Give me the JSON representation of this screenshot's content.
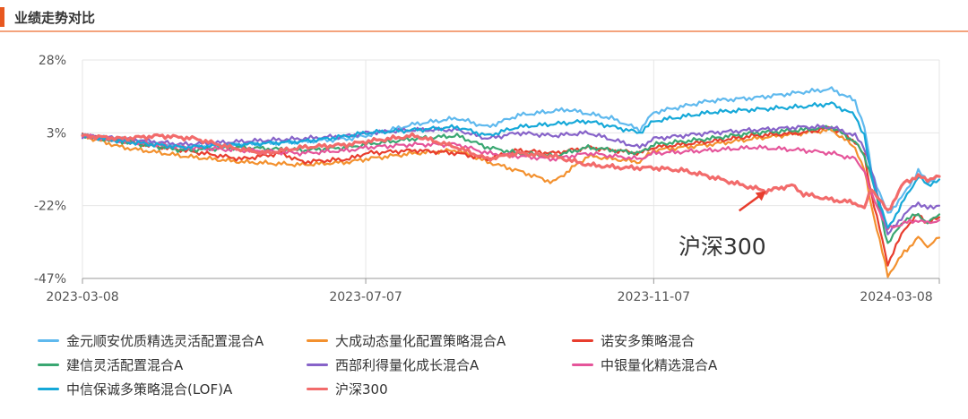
{
  "header": {
    "title": "业绩走势对比"
  },
  "chart_data": {
    "type": "line",
    "x_ticks": [
      "2023-03-08",
      "2023-07-07",
      "2023-11-07",
      "2024-03-08"
    ],
    "y_ticks": [
      "28%",
      "3%",
      "-22%",
      "-47%"
    ],
    "ylim": [
      -47,
      28
    ],
    "xlim": [
      "2023-03-08",
      "2024-03-08"
    ],
    "grid": true,
    "legend_position": "bottom",
    "annotation": {
      "text": "沪深300",
      "target_x": "2023-12-25",
      "target_y": -17
    },
    "series": [
      {
        "name": "金元顺安优质精选灵活配置混合A",
        "color": "#5fb9ee",
        "points": [
          [
            "2023-03-08",
            2
          ],
          [
            "2023-03-25",
            1
          ],
          [
            "2023-04-20",
            -2
          ],
          [
            "2023-05-15",
            -1
          ],
          [
            "2023-06-10",
            0
          ],
          [
            "2023-06-30",
            1
          ],
          [
            "2023-07-07",
            2
          ],
          [
            "2023-07-28",
            6
          ],
          [
            "2023-08-15",
            8
          ],
          [
            "2023-08-28",
            5
          ],
          [
            "2023-09-10",
            9
          ],
          [
            "2023-10-01",
            11
          ],
          [
            "2023-10-20",
            8
          ],
          [
            "2023-11-01",
            4
          ],
          [
            "2023-11-07",
            10
          ],
          [
            "2023-12-01",
            14
          ],
          [
            "2023-12-20",
            15
          ],
          [
            "2024-01-10",
            17
          ],
          [
            "2024-01-22",
            18
          ],
          [
            "2024-02-01",
            14
          ],
          [
            "2024-02-05",
            5
          ],
          [
            "2024-02-08",
            -10
          ],
          [
            "2024-02-15",
            -25
          ],
          [
            "2024-02-22",
            -18
          ],
          [
            "2024-02-28",
            -10
          ],
          [
            "2024-03-03",
            -14
          ],
          [
            "2024-03-08",
            -12
          ]
        ]
      },
      {
        "name": "大成动态量化配置策略混合A",
        "color": "#f3912f",
        "points": [
          [
            "2023-03-08",
            2
          ],
          [
            "2023-03-25",
            -2
          ],
          [
            "2023-04-20",
            -5
          ],
          [
            "2023-05-15",
            -7
          ],
          [
            "2023-06-10",
            -8
          ],
          [
            "2023-06-30",
            -7
          ],
          [
            "2023-07-07",
            -6
          ],
          [
            "2023-07-28",
            -4
          ],
          [
            "2023-08-15",
            -3
          ],
          [
            "2023-08-28",
            -7
          ],
          [
            "2023-09-10",
            -10
          ],
          [
            "2023-09-25",
            -14
          ],
          [
            "2023-10-10",
            -5
          ],
          [
            "2023-11-01",
            -7
          ],
          [
            "2023-11-07",
            -3
          ],
          [
            "2023-12-01",
            -1
          ],
          [
            "2023-12-20",
            1
          ],
          [
            "2024-01-10",
            3
          ],
          [
            "2024-01-22",
            4
          ],
          [
            "2024-02-01",
            -2
          ],
          [
            "2024-02-05",
            -10
          ],
          [
            "2024-02-08",
            -22
          ],
          [
            "2024-02-15",
            -46
          ],
          [
            "2024-02-22",
            -38
          ],
          [
            "2024-02-28",
            -33
          ],
          [
            "2024-03-03",
            -36
          ],
          [
            "2024-03-08",
            -33
          ]
        ]
      },
      {
        "name": "诺安多策略混合",
        "color": "#e83d2e",
        "points": [
          [
            "2023-03-08",
            2
          ],
          [
            "2023-03-25",
            0
          ],
          [
            "2023-04-20",
            -3
          ],
          [
            "2023-05-15",
            -6
          ],
          [
            "2023-06-01",
            -4
          ],
          [
            "2023-06-10",
            -7
          ],
          [
            "2023-06-30",
            -6
          ],
          [
            "2023-07-07",
            -4
          ],
          [
            "2023-07-28",
            -3
          ],
          [
            "2023-08-15",
            -4
          ],
          [
            "2023-08-28",
            -6
          ],
          [
            "2023-09-10",
            -3
          ],
          [
            "2023-09-25",
            -4
          ],
          [
            "2023-10-10",
            -2
          ],
          [
            "2023-11-01",
            -4
          ],
          [
            "2023-11-07",
            -2
          ],
          [
            "2023-12-01",
            0
          ],
          [
            "2023-12-20",
            2
          ],
          [
            "2024-01-10",
            3
          ],
          [
            "2024-01-22",
            5
          ],
          [
            "2024-02-01",
            0
          ],
          [
            "2024-02-05",
            -5
          ],
          [
            "2024-02-08",
            -18
          ],
          [
            "2024-02-15",
            -42
          ],
          [
            "2024-02-22",
            -30
          ],
          [
            "2024-02-28",
            -25
          ],
          [
            "2024-03-03",
            -28
          ],
          [
            "2024-03-08",
            -26
          ]
        ]
      },
      {
        "name": "建信灵活配置混合A",
        "color": "#3aa772",
        "points": [
          [
            "2023-03-08",
            2
          ],
          [
            "2023-03-25",
            0
          ],
          [
            "2023-04-20",
            -3
          ],
          [
            "2023-05-15",
            -2
          ],
          [
            "2023-06-10",
            -3
          ],
          [
            "2023-06-30",
            -2
          ],
          [
            "2023-07-07",
            -1
          ],
          [
            "2023-07-28",
            1
          ],
          [
            "2023-08-15",
            2
          ],
          [
            "2023-08-28",
            -2
          ],
          [
            "2023-09-10",
            -4
          ],
          [
            "2023-09-25",
            -5
          ],
          [
            "2023-10-10",
            -2
          ],
          [
            "2023-11-01",
            -4
          ],
          [
            "2023-11-07",
            -1
          ],
          [
            "2023-12-01",
            1
          ],
          [
            "2023-12-20",
            3
          ],
          [
            "2024-01-10",
            4
          ],
          [
            "2024-01-22",
            5
          ],
          [
            "2024-02-01",
            0
          ],
          [
            "2024-02-05",
            -5
          ],
          [
            "2024-02-08",
            -12
          ],
          [
            "2024-02-15",
            -35
          ],
          [
            "2024-02-22",
            -27
          ],
          [
            "2024-02-28",
            -25
          ],
          [
            "2024-03-03",
            -28
          ],
          [
            "2024-03-08",
            -25
          ]
        ]
      },
      {
        "name": "西部利得量化成长混合A",
        "color": "#8763c9",
        "points": [
          [
            "2023-03-08",
            2
          ],
          [
            "2023-03-25",
            1
          ],
          [
            "2023-04-20",
            -1
          ],
          [
            "2023-05-15",
            0
          ],
          [
            "2023-06-10",
            1
          ],
          [
            "2023-06-30",
            2
          ],
          [
            "2023-07-07",
            3
          ],
          [
            "2023-07-28",
            4
          ],
          [
            "2023-08-15",
            4
          ],
          [
            "2023-08-28",
            1
          ],
          [
            "2023-09-10",
            3
          ],
          [
            "2023-09-25",
            2
          ],
          [
            "2023-10-10",
            3
          ],
          [
            "2023-11-01",
            -2
          ],
          [
            "2023-11-07",
            1
          ],
          [
            "2023-12-01",
            3
          ],
          [
            "2023-12-20",
            4
          ],
          [
            "2024-01-10",
            5
          ],
          [
            "2024-01-22",
            5
          ],
          [
            "2024-02-01",
            2
          ],
          [
            "2024-02-05",
            -2
          ],
          [
            "2024-02-08",
            -10
          ],
          [
            "2024-02-15",
            -32
          ],
          [
            "2024-02-22",
            -25
          ],
          [
            "2024-02-28",
            -21
          ],
          [
            "2024-03-03",
            -23
          ],
          [
            "2024-03-08",
            -22
          ]
        ]
      },
      {
        "name": "中银量化精选混合A",
        "color": "#e5559a",
        "points": [
          [
            "2023-03-08",
            2
          ],
          [
            "2023-03-25",
            0
          ],
          [
            "2023-04-20",
            -2
          ],
          [
            "2023-05-15",
            -3
          ],
          [
            "2023-06-10",
            -4
          ],
          [
            "2023-06-30",
            -3
          ],
          [
            "2023-07-07",
            -2
          ],
          [
            "2023-07-28",
            -1
          ],
          [
            "2023-08-15",
            -1
          ],
          [
            "2023-08-28",
            -4
          ],
          [
            "2023-09-10",
            -5
          ],
          [
            "2023-09-25",
            -6
          ],
          [
            "2023-10-10",
            -4
          ],
          [
            "2023-11-01",
            -6
          ],
          [
            "2023-11-07",
            -4
          ],
          [
            "2023-12-01",
            -3
          ],
          [
            "2023-12-20",
            -2
          ],
          [
            "2024-01-10",
            -3
          ],
          [
            "2024-01-22",
            -4
          ],
          [
            "2024-02-01",
            -6
          ],
          [
            "2024-02-05",
            -10
          ],
          [
            "2024-02-08",
            -18
          ],
          [
            "2024-02-15",
            -30
          ],
          [
            "2024-02-22",
            -28
          ],
          [
            "2024-02-28",
            -27
          ],
          [
            "2024-03-03",
            -28
          ],
          [
            "2024-03-08",
            -27
          ]
        ]
      },
      {
        "name": "中信保诚多策略混合(LOF)A",
        "color": "#15a8d8",
        "points": [
          [
            "2023-03-08",
            2
          ],
          [
            "2023-03-25",
            0
          ],
          [
            "2023-04-20",
            -2
          ],
          [
            "2023-05-15",
            -1
          ],
          [
            "2023-06-10",
            0
          ],
          [
            "2023-06-30",
            2
          ],
          [
            "2023-07-07",
            3
          ],
          [
            "2023-07-28",
            4
          ],
          [
            "2023-08-15",
            5
          ],
          [
            "2023-08-28",
            2
          ],
          [
            "2023-09-10",
            5
          ],
          [
            "2023-09-25",
            6
          ],
          [
            "2023-10-10",
            7
          ],
          [
            "2023-11-01",
            3
          ],
          [
            "2023-11-07",
            7
          ],
          [
            "2023-12-01",
            10
          ],
          [
            "2023-12-20",
            11
          ],
          [
            "2024-01-10",
            12
          ],
          [
            "2024-01-22",
            13
          ],
          [
            "2024-02-01",
            9
          ],
          [
            "2024-02-05",
            2
          ],
          [
            "2024-02-08",
            -12
          ],
          [
            "2024-02-15",
            -30
          ],
          [
            "2024-02-22",
            -20
          ],
          [
            "2024-02-28",
            -12
          ],
          [
            "2024-03-03",
            -15
          ],
          [
            "2024-03-08",
            -13
          ]
        ]
      },
      {
        "name": "沪深300",
        "color": "#f26b6b",
        "points": [
          [
            "2023-03-08",
            2
          ],
          [
            "2023-03-25",
            1
          ],
          [
            "2023-04-10",
            2
          ],
          [
            "2023-04-25",
            1
          ],
          [
            "2023-05-10",
            -2
          ],
          [
            "2023-05-25",
            -4
          ],
          [
            "2023-06-10",
            -2
          ],
          [
            "2023-06-30",
            -1
          ],
          [
            "2023-07-07",
            0
          ],
          [
            "2023-07-28",
            2
          ],
          [
            "2023-08-15",
            -2
          ],
          [
            "2023-08-28",
            -6
          ],
          [
            "2023-09-10",
            -4
          ],
          [
            "2023-09-25",
            -5
          ],
          [
            "2023-10-10",
            -8
          ],
          [
            "2023-10-25",
            -9
          ],
          [
            "2023-11-07",
            -9
          ],
          [
            "2023-11-20",
            -10
          ],
          [
            "2023-12-01",
            -12
          ],
          [
            "2023-12-15",
            -15
          ],
          [
            "2023-12-25",
            -17
          ],
          [
            "2024-01-05",
            -15
          ],
          [
            "2024-01-10",
            -18
          ],
          [
            "2024-01-22",
            -20
          ],
          [
            "2024-02-01",
            -21
          ],
          [
            "2024-02-05",
            -23
          ],
          [
            "2024-02-08",
            -16
          ],
          [
            "2024-02-15",
            -24
          ],
          [
            "2024-02-22",
            -14
          ],
          [
            "2024-02-28",
            -12
          ],
          [
            "2024-03-03",
            -13
          ],
          [
            "2024-03-08",
            -12
          ]
        ]
      }
    ]
  }
}
